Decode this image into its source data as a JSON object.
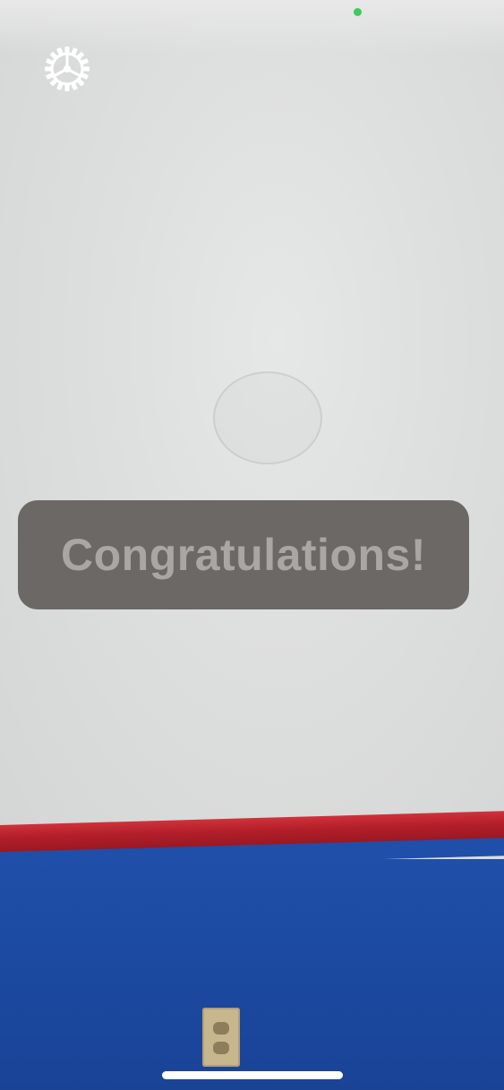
{
  "status_bar": {
    "indicator_color": "#3ecb5a"
  },
  "toolbar": {
    "settings_icon": "gear-icon"
  },
  "message": {
    "text": "Congratulations!",
    "background_color": "#6b6866",
    "text_color": "#a9a6a4"
  },
  "scene": {
    "wall_color": "#dedfdf",
    "trim_color": "#b31f2a",
    "lower_wall_color": "#1b49a0"
  },
  "home_indicator": {
    "color": "#ffffff"
  }
}
